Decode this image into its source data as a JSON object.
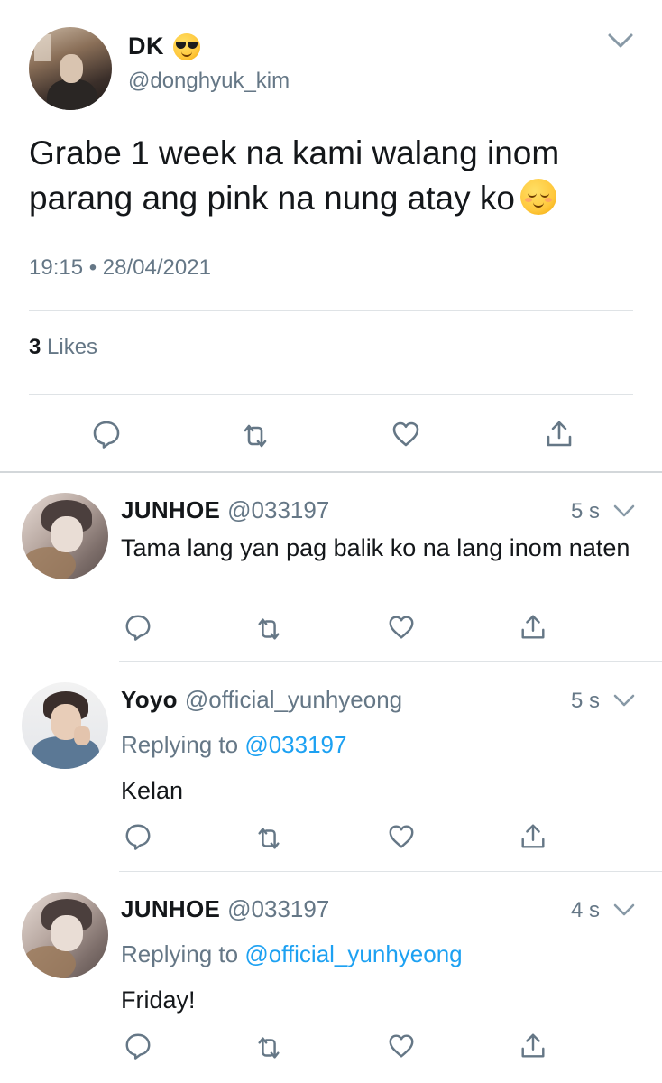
{
  "main_tweet": {
    "display_name": "DK",
    "name_emoji": "smiling-face-with-sunglasses",
    "handle": "@donghyuk_kim",
    "text": "Grabe 1 week na kami walang inom parang ang pink na nung atay ko",
    "text_emoji": "relieved-face",
    "timestamp": "19:15 • 28/04/2021",
    "likes_count": "3",
    "likes_label": "Likes"
  },
  "replies": [
    {
      "display_name": "JUNHOE",
      "handle": "@033197",
      "time": "5 s",
      "replying_label": "",
      "replying_to": "",
      "text": "Tama lang yan pag balik ko na lang inom naten"
    },
    {
      "display_name": "Yoyo",
      "handle": "@official_yunhyeong",
      "time": "5 s",
      "replying_label": "Replying to",
      "replying_to": "@033197",
      "text": "Kelan"
    },
    {
      "display_name": "JUNHOE",
      "handle": "@033197",
      "time": "4 s",
      "replying_label": "Replying to",
      "replying_to": "@official_yunhyeong",
      "text": "Friday!"
    }
  ],
  "colors": {
    "text": "#14171a",
    "secondary": "#657786",
    "link": "#1da1f2",
    "divider": "#dfe3e6"
  },
  "icons": [
    "reply-icon",
    "retweet-icon",
    "like-icon",
    "share-icon",
    "chevron-down-icon"
  ]
}
